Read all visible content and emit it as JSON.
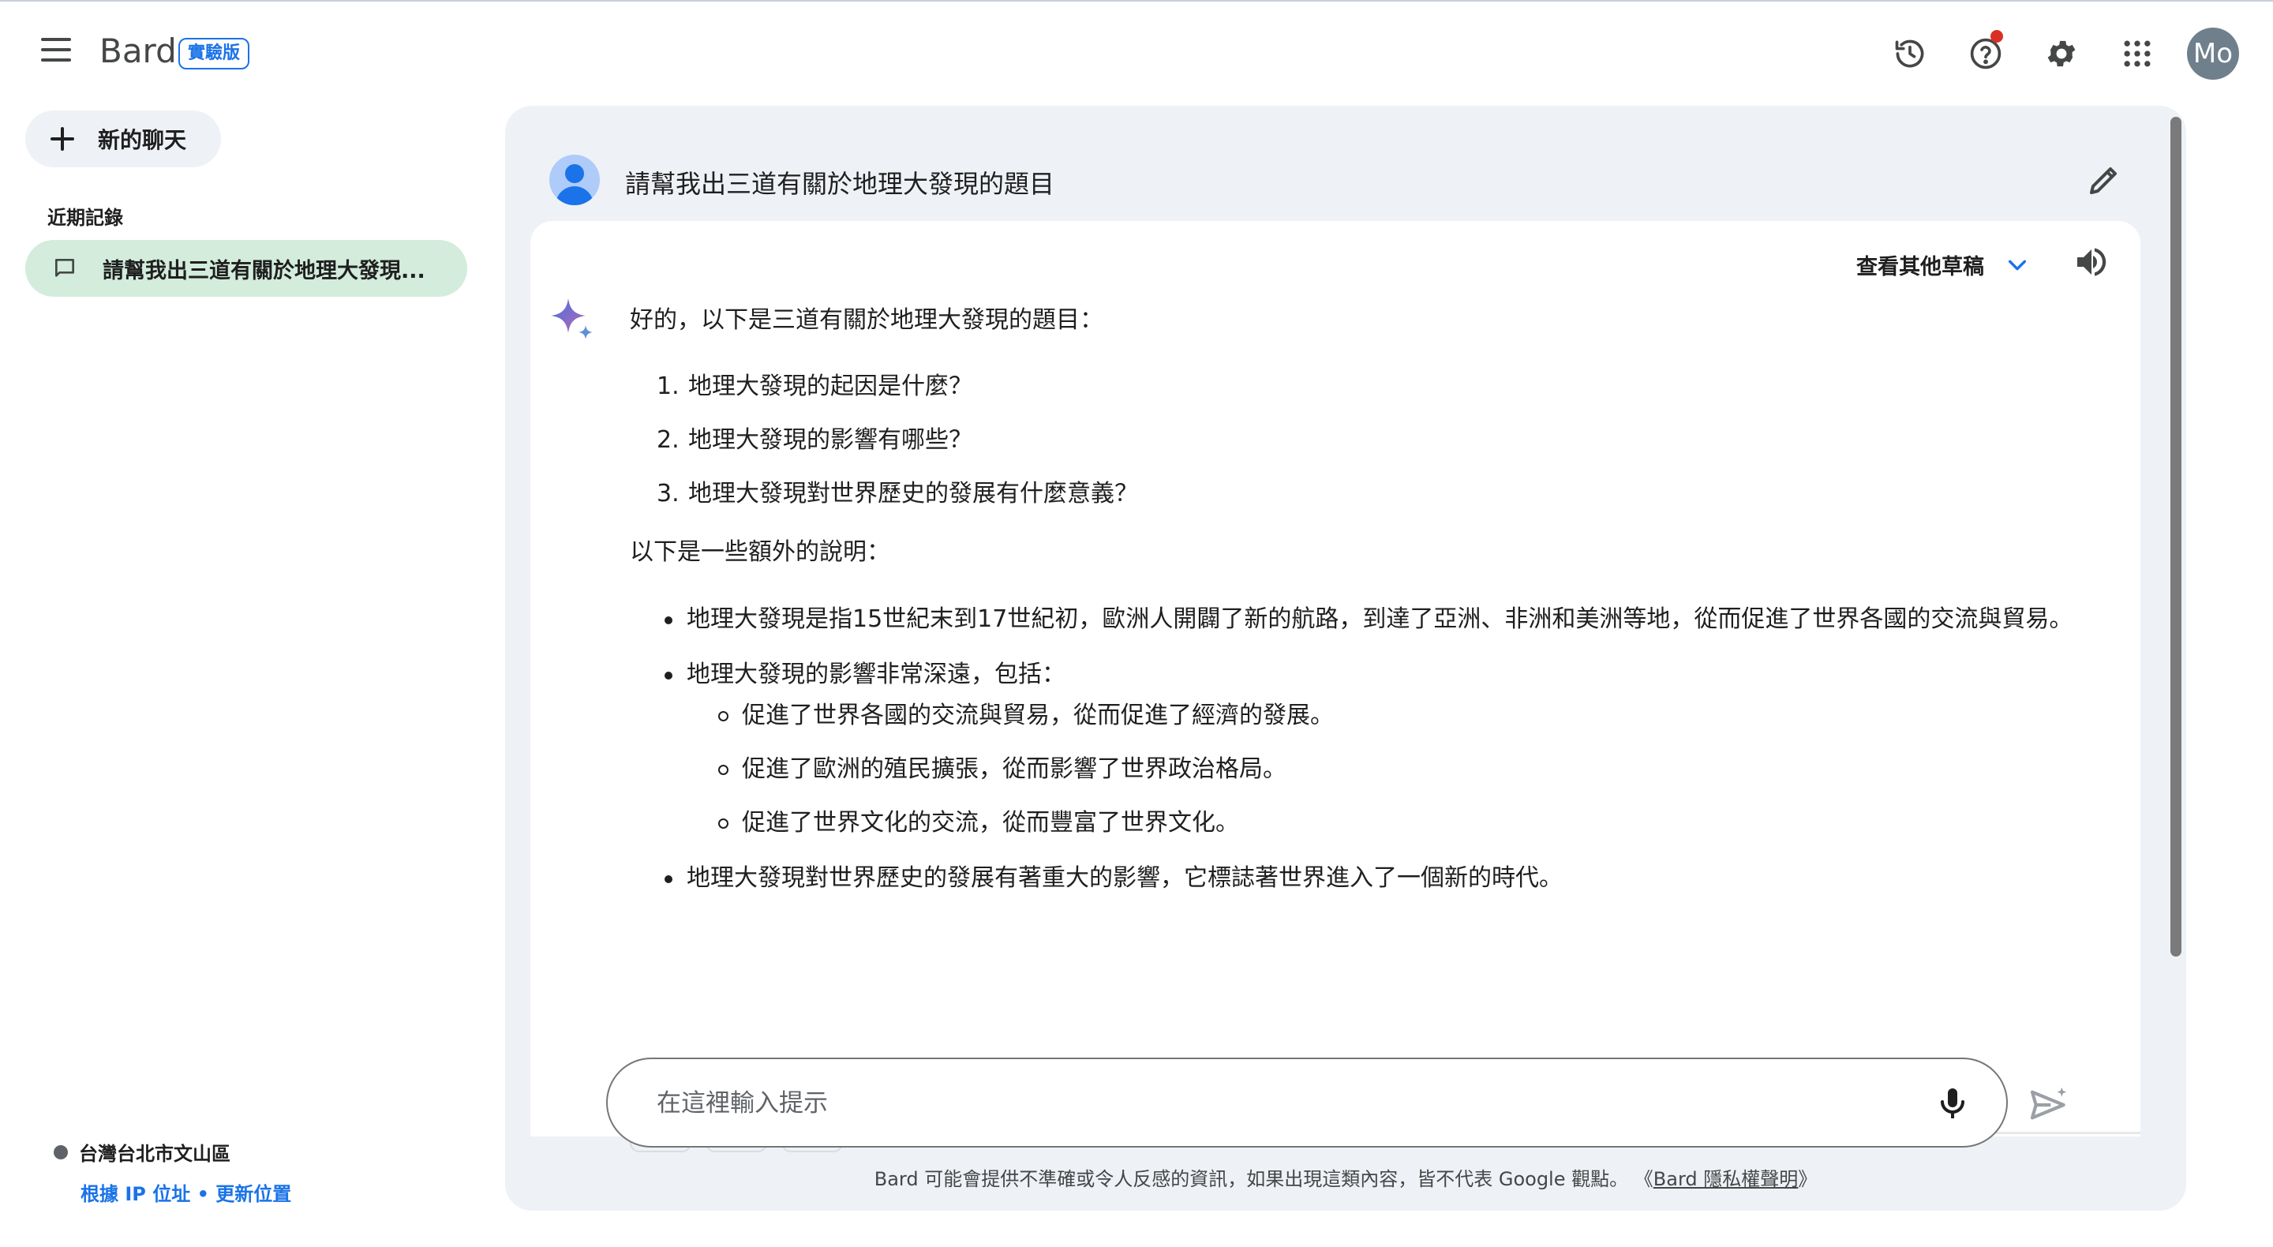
{
  "header": {
    "brand": "Bard",
    "badge": "實驗版",
    "avatar_initials": "Mo",
    "icons": [
      "history-icon",
      "help-icon",
      "settings-icon",
      "apps-grid-icon"
    ]
  },
  "sidebar": {
    "new_chat_label": "新的聊天",
    "recent_title": "近期記錄",
    "recent_items": [
      {
        "label": "請幫我出三道有關於地理大發現..."
      }
    ],
    "location": {
      "place": "台灣台北市文山區",
      "ip_link": "根據 IP 位址",
      "separator": " • ",
      "update_link": "更新位置"
    }
  },
  "conversation": {
    "user_prompt": "請幫我出三道有關於地理大發現的題目",
    "drafts_label": "查看其他草稿",
    "response": {
      "intro": "好的，以下是三道有關於地理大發現的題目：",
      "questions": [
        {
          "num": "1.",
          "text": "地理大發現的起因是什麼？"
        },
        {
          "num": "2.",
          "text": "地理大發現的影響有哪些？"
        },
        {
          "num": "3.",
          "text": "地理大發現對世界歷史的發展有什麼意義？"
        }
      ],
      "extra_intro": "以下是一些額外的說明：",
      "bullet_1": "地理大發現是指15世紀末到17世紀初，歐洲人開闢了新的航路，到達了亞洲、非洲和美洲等地，從而促進了世界各國的交流與貿易。",
      "bullet_2": "地理大發現的影響非常深遠，包括：",
      "sub_bullets": [
        "促進了世界各國的交流與貿易，從而促進了經濟的發展。",
        "促進了歐洲的殖民擴張，從而影響了世界政治格局。",
        "促進了世界文化的交流，從而豐富了世界文化。"
      ],
      "bullet_3": "地理大發現對世界歷史的發展有著重大的影響，它標誌著世界進入了一個新的時代。"
    }
  },
  "input": {
    "placeholder": "在這裡輸入提示",
    "value": ""
  },
  "footer": {
    "disclaimer": "Bard 可能會提供不準確或令人反感的資訊，如果出現這類內容，皆不代表 Google 觀點。",
    "privacy_open": "《",
    "privacy_link": "Bard 隱私權聲明",
    "privacy_close": "》"
  },
  "colors": {
    "accent": "#1a73e8",
    "panel_bg": "#eef1f6",
    "recent_active_bg": "#d3ecdc",
    "notification_dot": "#d93025"
  }
}
